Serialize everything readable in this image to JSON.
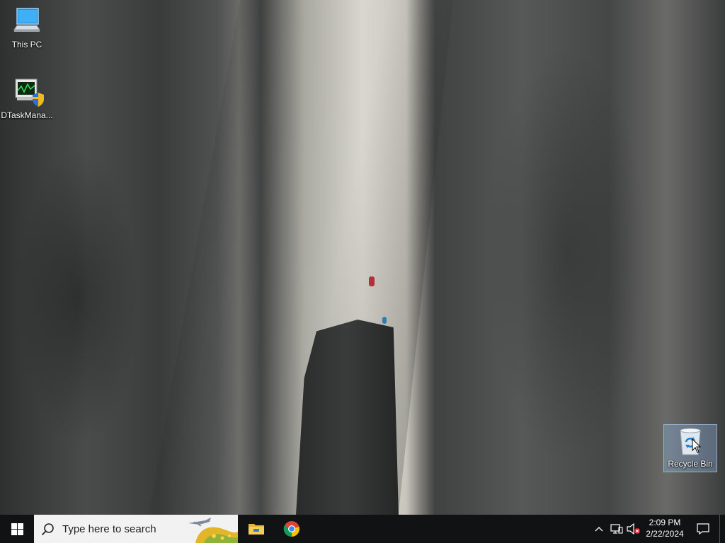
{
  "desktop": {
    "icons": [
      {
        "label": "This PC",
        "icon": "this-pc-icon"
      },
      {
        "label": "DTaskMana...",
        "icon": "task-manager-icon"
      },
      {
        "label": "Recycle Bin",
        "icon": "recycle-bin-icon"
      }
    ]
  },
  "taskbar": {
    "start_icon": "windows-logo-icon",
    "search": {
      "placeholder": "Type here to search"
    },
    "apps": [
      {
        "name": "File Explorer",
        "icon": "file-explorer-icon"
      },
      {
        "name": "Google Chrome",
        "icon": "chrome-icon"
      }
    ],
    "tray": {
      "time": "2:09 PM",
      "date": "2/22/2024"
    }
  },
  "colors": {
    "taskbar_bg": "#101214",
    "search_bg": "#f2f2f2",
    "accent": "#0078d7"
  }
}
